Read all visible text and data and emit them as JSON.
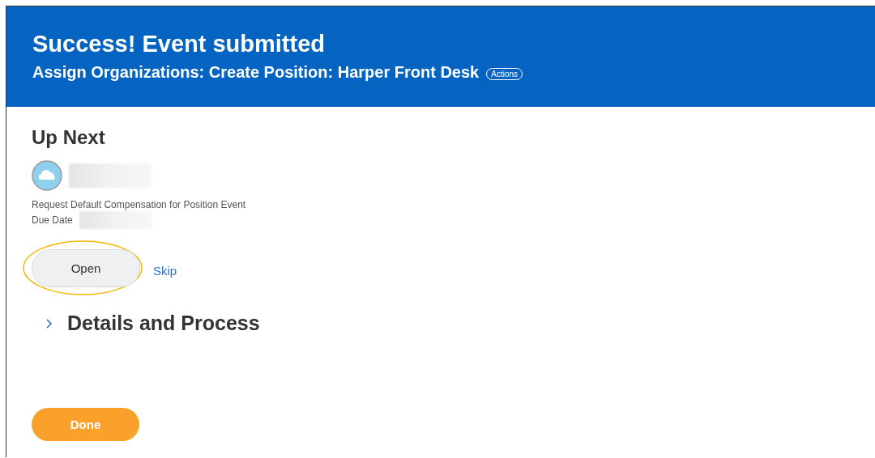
{
  "header": {
    "title": "Success! Event submitted",
    "subtitle": "Assign Organizations: Create Position: Harper Front Desk",
    "actions_label": "Actions"
  },
  "up_next": {
    "heading": "Up Next",
    "task": "Request Default Compensation for Position Event",
    "due_date_label": "Due Date",
    "open_button": "Open",
    "open_highlighted": true,
    "skip_link": "Skip"
  },
  "details": {
    "title": "Details and Process",
    "expanded": false
  },
  "done_button": "Done"
}
